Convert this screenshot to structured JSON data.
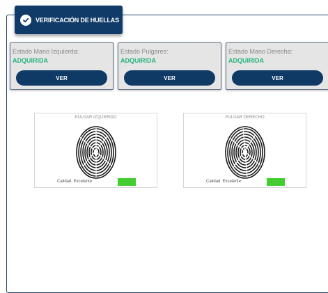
{
  "header": {
    "title": "VERIFICACIÓN DE HUELLAS",
    "icon": "check-circle-icon"
  },
  "status_cards": [
    {
      "label": "Estado Mano Izquierda:",
      "value": "ADQUIRIDA",
      "button_label": "VER"
    },
    {
      "label": "Estado Pulgares:",
      "value": "ADQUIRIDA",
      "button_label": "VER"
    },
    {
      "label": "Estado Mano Derecha:",
      "value": "ADQUIRIDA",
      "button_label": "VER"
    }
  ],
  "fingerprints": [
    {
      "title": "PULGAR IZQUIERDO",
      "quality_label": "Calidad: Excelente",
      "quality_color": "#44cc33"
    },
    {
      "title": "PULGAR DERECHO",
      "quality_label": "Calidad: Excelente",
      "quality_color": "#44cc33"
    }
  ],
  "colors": {
    "primary": "#103a68",
    "success_text": "#26b57a",
    "quality_good": "#44cc33"
  }
}
